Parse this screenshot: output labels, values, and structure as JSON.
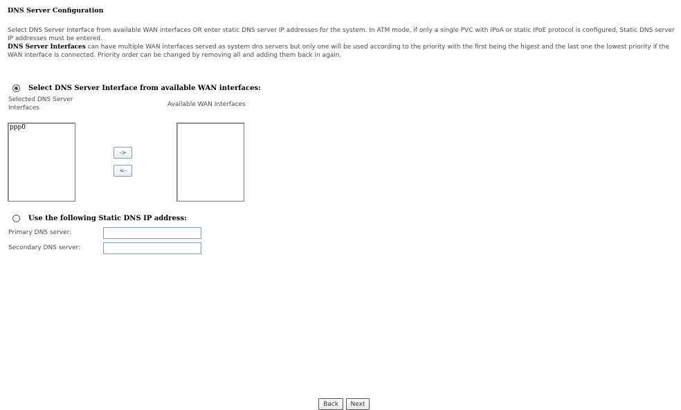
{
  "page": {
    "title": "DNS Server Configuration",
    "desc_line1": "Select DNS Server Interface from available WAN interfaces OR enter static DNS server IP addresses for the system. In ATM mode, if only a single PVC with IPoA or static IPoE protocol is configured, Static DNS server IP addresses must be entered.",
    "desc_bold": "DNS Server Interfaces",
    "desc_line2": " can have multiple WAN interfaces served as system dns servers but only one will be used according to the priority with the first being the higest and the last one the lowest priority if the WAN interface is connected. Priority order can be changed by removing all and adding them back in again."
  },
  "interface_mode": {
    "label": "Select DNS Server Interface from available WAN interfaces:",
    "selected": true,
    "selected_label": "Selected DNS Server Interfaces",
    "available_label": "Available WAN Interfaces",
    "selected_items": [
      "ppp0"
    ],
    "available_items": [],
    "add_button": "->",
    "remove_button": "<-"
  },
  "static_mode": {
    "label": "Use the following Static DNS IP address:",
    "selected": false,
    "primary_label": "Primary DNS server:",
    "primary_value": "",
    "secondary_label": "Secondary DNS server:",
    "secondary_value": ""
  },
  "nav": {
    "back": "Back",
    "next": "Next"
  }
}
